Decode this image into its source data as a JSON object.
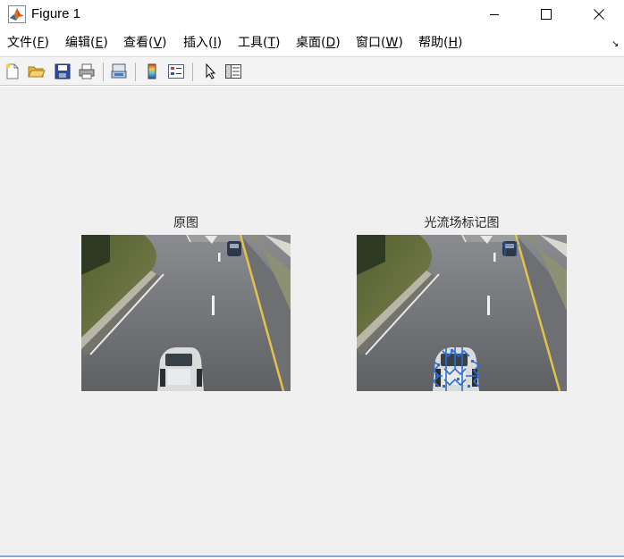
{
  "window": {
    "title": "Figure 1"
  },
  "menubar": {
    "items": [
      {
        "label": "文件(",
        "mnemonic": "F",
        "close": ")"
      },
      {
        "label": "编辑(",
        "mnemonic": "E",
        "close": ")"
      },
      {
        "label": "查看(",
        "mnemonic": "V",
        "close": ")"
      },
      {
        "label": "插入(",
        "mnemonic": "I",
        "close": ")"
      },
      {
        "label": "工具(",
        "mnemonic": "T",
        "close": ")"
      },
      {
        "label": "桌面(",
        "mnemonic": "D",
        "close": ")"
      },
      {
        "label": "窗口(",
        "mnemonic": "W",
        "close": ")"
      },
      {
        "label": "帮助(",
        "mnemonic": "H",
        "close": ")"
      }
    ]
  },
  "toolbar": {
    "icons": [
      "new-figure-icon",
      "open-file-icon",
      "save-icon",
      "print-icon",
      "link-plot-icon",
      "insert-colorbar-icon",
      "insert-legend-icon",
      "pointer-icon",
      "property-inspector-icon"
    ]
  },
  "figure": {
    "subplots": [
      {
        "title": "原图"
      },
      {
        "title": "光流场标记图"
      }
    ]
  },
  "colors": {
    "canvas_bg": "#f0f0f0",
    "toolbar_bg": "#f3f3f3",
    "flow_marker": "#2a6fd6"
  }
}
